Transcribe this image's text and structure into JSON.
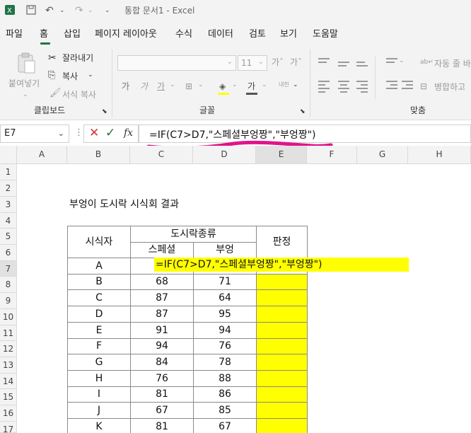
{
  "app": {
    "title": "통합 문서1  -  Excel"
  },
  "ribbon": {
    "tabs": [
      "파일",
      "홈",
      "삽입",
      "페이지 레이아웃",
      "수식",
      "데이터",
      "검토",
      "보기",
      "도움말"
    ],
    "active_tab": "홈",
    "clipboard": {
      "paste": "붙여넣기",
      "cut": "잘라내기",
      "copy": "복사",
      "format_painter": "서식 복사",
      "label": "클립보드"
    },
    "font": {
      "size": "11",
      "label": "글꼴"
    },
    "alignment": {
      "wrap": "자동 줄 바",
      "merge": "병합하고",
      "label": "맞춤"
    }
  },
  "formula_bar": {
    "name_box": "E7",
    "formula": "=IF(C7>D7,\"스페셜부엉짱\",\"부엉짱\")",
    "fx": "fx"
  },
  "grid": {
    "columns": [
      "A",
      "B",
      "C",
      "D",
      "E",
      "F",
      "G",
      "H"
    ],
    "rows": [
      "1",
      "2",
      "3",
      "4",
      "5",
      "6",
      "7",
      "8",
      "9",
      "10",
      "11",
      "12",
      "13",
      "14",
      "15",
      "16",
      "17"
    ],
    "title": "부엉이 도시락 시식회 결과",
    "table": {
      "h_taster": "시식자",
      "h_lunchbox": "도시락종류",
      "h_special": "스페셜",
      "h_owl": "부엉",
      "h_verdict": "판정",
      "edit_formula": "=IF(C7>D7,\"스페셜부엉짱\",\"부엉짱\")",
      "rows": [
        {
          "name": "A",
          "special": "",
          "owl": ""
        },
        {
          "name": "B",
          "special": "68",
          "owl": "71"
        },
        {
          "name": "C",
          "special": "87",
          "owl": "64"
        },
        {
          "name": "D",
          "special": "87",
          "owl": "95"
        },
        {
          "name": "E",
          "special": "91",
          "owl": "94"
        },
        {
          "name": "F",
          "special": "94",
          "owl": "76"
        },
        {
          "name": "G",
          "special": "84",
          "owl": "78"
        },
        {
          "name": "H",
          "special": "76",
          "owl": "88"
        },
        {
          "name": "I",
          "special": "81",
          "owl": "86"
        },
        {
          "name": "J",
          "special": "67",
          "owl": "85"
        },
        {
          "name": "K",
          "special": "81",
          "owl": "67"
        }
      ]
    }
  },
  "colors": {
    "accent": "#217346",
    "highlight": "#ffff00",
    "annotation": "#e0148c"
  }
}
